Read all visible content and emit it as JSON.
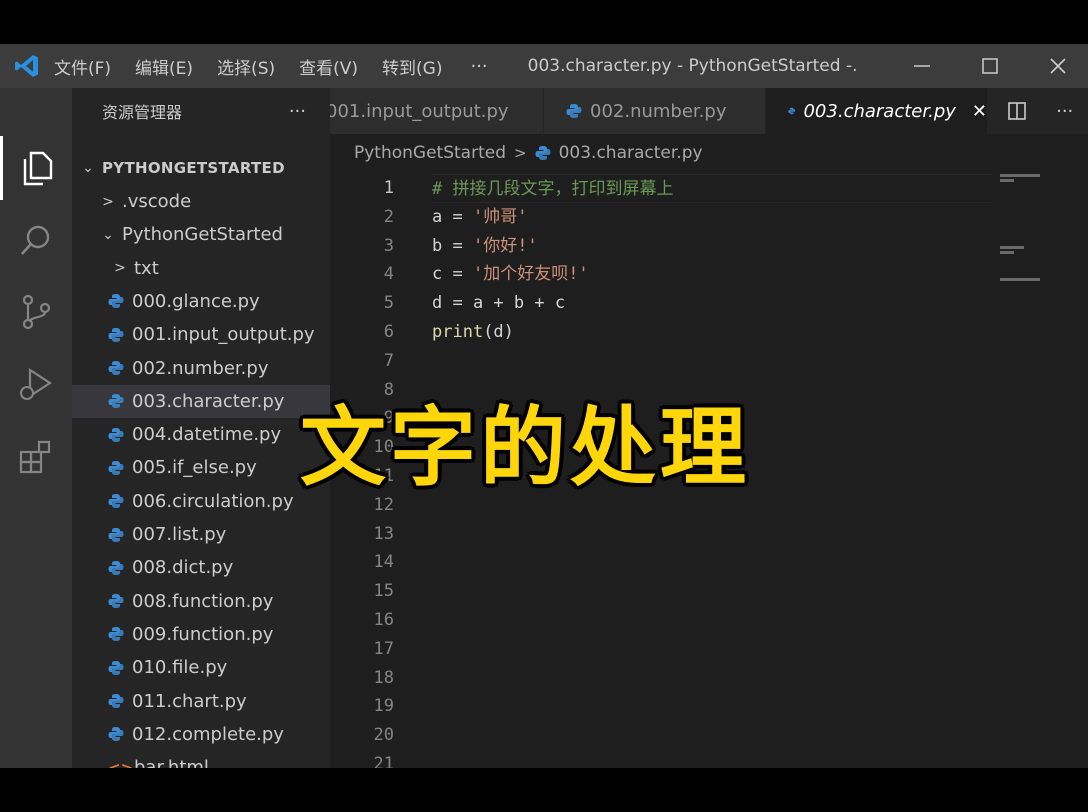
{
  "titlebar": {
    "menu": [
      "文件(F)",
      "编辑(E)",
      "选择(S)",
      "查看(V)",
      "转到(G)"
    ],
    "more": "···",
    "window_title": "003.character.py - PythonGetStarted -..."
  },
  "sidebar": {
    "header": "资源管理器",
    "more": "···",
    "root": "PYTHONGETSTARTED",
    "items": [
      {
        "label": ".vscode",
        "type": "folder-collapsed"
      },
      {
        "label": "PythonGetStarted",
        "type": "folder-open"
      },
      {
        "label": "txt",
        "type": "folder-collapsed"
      },
      {
        "label": "000.glance.py",
        "type": "py"
      },
      {
        "label": "001.input_output.py",
        "type": "py"
      },
      {
        "label": "002.number.py",
        "type": "py"
      },
      {
        "label": "003.character.py",
        "type": "py",
        "selected": true
      },
      {
        "label": "004.datetime.py",
        "type": "py"
      },
      {
        "label": "005.if_else.py",
        "type": "py"
      },
      {
        "label": "006.circulation.py",
        "type": "py"
      },
      {
        "label": "007.list.py",
        "type": "py"
      },
      {
        "label": "008.dict.py",
        "type": "py"
      },
      {
        "label": "008.function.py",
        "type": "py"
      },
      {
        "label": "009.function.py",
        "type": "py"
      },
      {
        "label": "010.file.py",
        "type": "py"
      },
      {
        "label": "011.chart.py",
        "type": "py"
      },
      {
        "label": "012.complete.py",
        "type": "py"
      },
      {
        "label": "bar.html",
        "type": "html"
      }
    ]
  },
  "tabs": [
    {
      "label": "001.input_output.py"
    },
    {
      "label": "002.number.py"
    },
    {
      "label": "003.character.py",
      "active": true
    }
  ],
  "breadcrumb": {
    "folder": "PythonGetStarted",
    "file": "003.character.py"
  },
  "code_lines": [
    "# 拼接几段文字，打印到屏幕上",
    "a = '帅哥'",
    "b = '你好!'",
    "c = '加个好友呗!'",
    "d = a + b + c",
    "print(d)"
  ],
  "line_numbers": [
    "1",
    "2",
    "3",
    "4",
    "5",
    "6",
    "7",
    "8",
    "9",
    "10",
    "11",
    "12",
    "13",
    "14",
    "15",
    "16",
    "17",
    "18",
    "19",
    "20",
    "21"
  ],
  "overlay_caption": "文字的处理",
  "colors": {
    "accent": "#007acc",
    "caption": "#ffd60a"
  }
}
